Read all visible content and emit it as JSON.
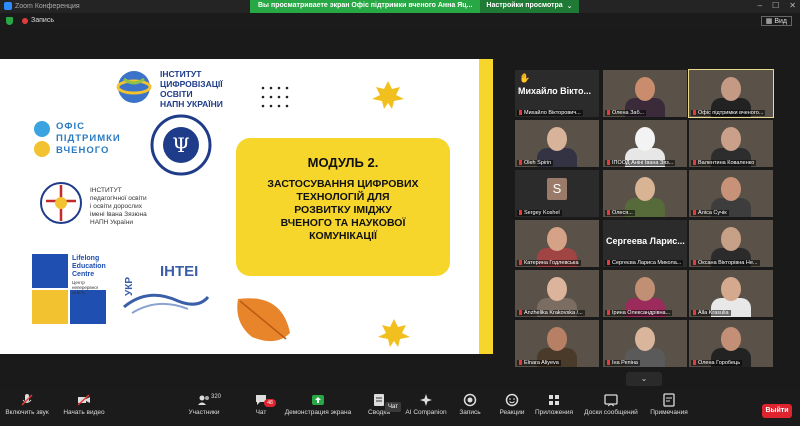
{
  "window": {
    "title": "Zoom Конференция"
  },
  "share_banner": {
    "message": "Вы просматриваете экран Офіс підтримки вченого Анна Яц...",
    "view_options": "Настройки просмотра"
  },
  "meeting": {
    "recording_label": "Запись",
    "view_label": "Вид"
  },
  "slide": {
    "institute_top": "ІНСТИТУТ\nЦИФРОВІЗАЦІЇ\nОСВІТИ\nНАПН УКРАЇНИ",
    "office": "ОФІС\nПІДТРИМКИ\nВЧЕНОГО",
    "institute_psych": "ІНСТИТУТ СОЦІАЛЬНОЇ ТА ПОЛІТИЧНОЇ ПСИХОЛОГІЇ НАПН УКРАЇНИ",
    "institute_ped": "ІНСТИТУТ\nпедагогічної освіти\nі освіти дорослих\nімені Івана Зязюна\nНАПН України",
    "lifelong": "Lifelong\nEducation\nCentre",
    "lifelong_sub": "Центр\nнеперервної\nосвіти",
    "ukr_label": "УКР",
    "intei_label": "ІНТЕІ",
    "module_title": "МОДУЛЬ 2.",
    "module_text": "ЗАСТОСУВАННЯ ЦИФРОВИХ\nТЕХНОЛОГІЙ ДЛЯ\nРОЗВИТКУ ІМІДЖУ\nВЧЕНОГО ТА НАУКОВОЇ\nКОМУНІКАЦІЇ"
  },
  "participants": [
    {
      "name": "Михайло Вікто...",
      "label": "Михайло Вікторович...",
      "video": false,
      "hand": true
    },
    {
      "name": "",
      "label": "Олена Заб...",
      "video": true,
      "face": "#c98d6e",
      "body": "#3a2a3a"
    },
    {
      "name": "",
      "label": "Офіс підтримки вченого...",
      "video": true,
      "face": "#c49a84",
      "body": "#222",
      "highlight": true
    },
    {
      "name": "",
      "label": "Oleh Spirin",
      "video": true,
      "face": "#d9b29a",
      "body": "#334"
    },
    {
      "name": "",
      "label": "ІПООД Аніні Івана Зяз...",
      "video": true,
      "face": "#f3f3f3",
      "body": "#e7e7e7"
    },
    {
      "name": "",
      "label": "Валентина Коваленко",
      "video": true,
      "face": "#caa08a",
      "body": "#2d2d2d"
    },
    {
      "name": "S",
      "label": "Sergey Koshel",
      "video": false,
      "avatar": true
    },
    {
      "name": "",
      "label": "Олеся...",
      "video": true,
      "face": "#d8b394",
      "body": "#576a3a"
    },
    {
      "name": "",
      "label": "Аліса Сучік",
      "video": true,
      "face": "#c89278",
      "body": "#3d3d3d"
    },
    {
      "name": "",
      "label": "Катерина Годлевська",
      "video": true,
      "face": "#d5a187",
      "body": "#a04444"
    },
    {
      "name": "Сергеева Ларис...",
      "label": "Сергеєва Лариса Микола...",
      "video": false
    },
    {
      "name": "",
      "label": "Оксана Вікторівна Не...",
      "video": true,
      "face": "#c7a088",
      "body": "#2b2b2b"
    },
    {
      "name": "",
      "label": "Anzhelika Krakovska /...",
      "video": true,
      "face": "#dcb39b",
      "body": "#7b6d62"
    },
    {
      "name": "",
      "label": "Ірина Олександрівна...",
      "video": true,
      "face": "#c08f74",
      "body": "#9b2b5b"
    },
    {
      "name": "",
      "label": "Alla Krasulia",
      "video": true,
      "face": "#d4a98e",
      "body": "#e8e8e8"
    },
    {
      "name": "",
      "label": "Elnara Aliyeva",
      "video": true,
      "face": "#b78065",
      "body": "#4a3a2a"
    },
    {
      "name": "",
      "label": "Іна Репіна",
      "video": true,
      "face": "#d9b59c",
      "body": "#5a5a5a"
    },
    {
      "name": "",
      "label": "Олена Горобець",
      "video": true,
      "face": "#c39077",
      "body": "#222"
    }
  ],
  "toolbar": {
    "audio": "Включить звук",
    "video": "Начать видео",
    "participants": "Участники",
    "participants_count": "320",
    "chat": "Чат",
    "chat_badge": "48",
    "share": "Демонстрация экрана",
    "summary": "Сводка",
    "ai": "AI Companion",
    "record": "Запись",
    "reactions": "Реакции",
    "apps": "Приложения",
    "whiteboards": "Доски сообщений",
    "notes": "Примечания",
    "leave": "Выйти",
    "chat_tooltip": "Чат"
  },
  "colors": {
    "accent": "#2d8cff",
    "share_green": "#27a844",
    "leave_red": "#e0242f",
    "slide_yellow": "#f6d62b"
  }
}
